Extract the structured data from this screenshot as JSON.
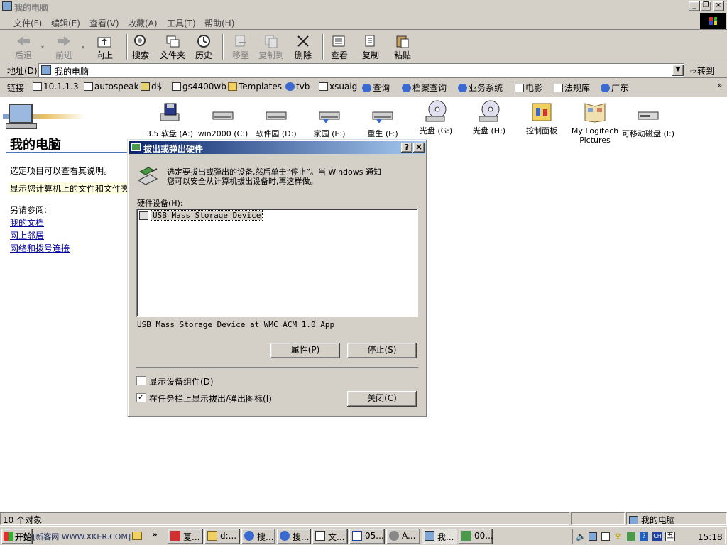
{
  "window": {
    "title": "我的电脑"
  },
  "menu": [
    "文件(F)",
    "编辑(E)",
    "查看(V)",
    "收藏(A)",
    "工具(T)",
    "帮助(H)"
  ],
  "toolbar": {
    "back": "后退",
    "forward": "前进",
    "up": "向上",
    "search": "搜索",
    "folders": "文件夹",
    "history": "历史",
    "move_to": "移至",
    "copy_to": "复制到",
    "delete": "删除",
    "views": "查看",
    "copy": "复制",
    "paste": "粘贴"
  },
  "address": {
    "label": "地址(D)",
    "value": "我的电脑",
    "go": "转到"
  },
  "links": {
    "label": "链接",
    "items": [
      "10.1.1.3",
      "autospeak",
      "d$",
      "gs4400wb",
      "Templates",
      "tvb",
      "xsuaig",
      "查询",
      "档案查询",
      "业务系统",
      "电影",
      "法规库",
      "广东"
    ]
  },
  "left_panel": {
    "title": "我的电脑",
    "desc": "选定项目可以查看其说明。",
    "desc2": "显示您计算机上的文件和文件夹",
    "see_also": "另请参阅:",
    "links": [
      "我的文档",
      "网上邻居",
      "网络和拨号连接"
    ]
  },
  "drives": [
    {
      "label": "3.5 软盘 (A:)",
      "icon": "floppy-drive-icon"
    },
    {
      "label": "win2000 (C:)",
      "icon": "hard-drive-icon"
    },
    {
      "label": "软件园 (D:)",
      "icon": "hard-drive-icon"
    },
    {
      "label": "家园 (E:)",
      "icon": "hard-drive-icon"
    },
    {
      "label": "重生 (F:)",
      "icon": "hard-drive-icon"
    },
    {
      "label": "光盘 (G:)",
      "icon": "cd-drive-icon"
    },
    {
      "label": "光盘 (H:)",
      "icon": "cd-drive-icon"
    },
    {
      "label": "控制面板",
      "icon": "control-panel-icon"
    },
    {
      "label": "My Logitech Pictures",
      "icon": "pictures-folder-icon"
    },
    {
      "label": "可移动磁盘 (I:)",
      "icon": "removable-disk-icon"
    }
  ],
  "dialog": {
    "title": "拔出或弹出硬件",
    "help": "?",
    "close_x": "×",
    "instructions_1": "选定要拔出或弹出的设备,然后单击“停止”。当 Windows 通知",
    "instructions_2": "您可以安全从计算机拔出设备时,再这样做。",
    "hw_label": "硬件设备(H):",
    "devices": [
      "USB Mass Storage Device"
    ],
    "device_desc": "USB Mass Storage Device at WMC ACM 1.0 App",
    "properties": "属性(P)",
    "stop": "停止(S)",
    "show_components": "显示设备组件(D)",
    "show_components_checked": false,
    "show_tray_icon": "在任务栏上显示拔出/弹出图标(I)",
    "show_tray_icon_checked": true,
    "close": "关闭(C)"
  },
  "status": {
    "count": "10 个对象",
    "location": "我的电脑"
  },
  "taskbar": {
    "start": "开始",
    "ime": "[新客网 WWW.XKER.COM]",
    "tasks": [
      "夏...",
      "d:...",
      "搜...",
      "搜...",
      "文...",
      "05...",
      "A...",
      "我...",
      "00..."
    ],
    "tray_ime": "五",
    "clock": "15:18"
  }
}
